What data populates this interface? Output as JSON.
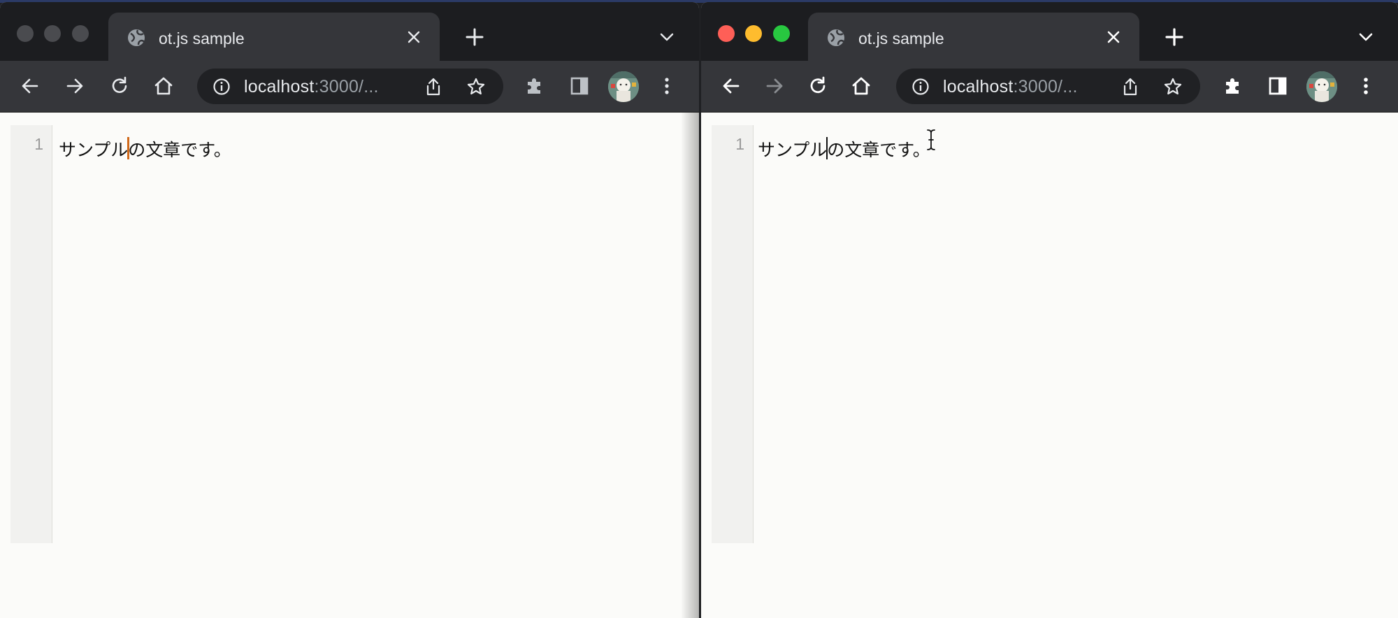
{
  "windows": [
    {
      "tab": {
        "title": "ot.js sample"
      },
      "omnibox": {
        "host": "localhost",
        "rest": ":3000/..."
      },
      "editor": {
        "line_numbers": [
          "1"
        ],
        "text_before_cursor": "サンプル",
        "text_after_cursor": "の文章です。",
        "cursor_color": "#d0691b"
      }
    },
    {
      "tab": {
        "title": "ot.js sample"
      },
      "omnibox": {
        "host": "localhost",
        "rest": ":3000/..."
      },
      "editor": {
        "line_numbers": [
          "1"
        ],
        "text_before_cursor": "サンプル",
        "text_after_cursor": "の文章です。",
        "cursor_color": "#111111"
      }
    }
  ],
  "icons": {
    "traffic_lights": [
      "close-traffic-light",
      "minimize-traffic-light",
      "maximize-traffic-light"
    ],
    "tab": [
      "globe-icon",
      "close-icon"
    ],
    "tabstrip": [
      "plus-icon",
      "chevron-down-icon"
    ],
    "toolbar": [
      "back-arrow-icon",
      "forward-arrow-icon",
      "reload-icon",
      "home-icon",
      "info-icon",
      "share-icon",
      "star-icon",
      "puzzle-icon",
      "side-panel-icon",
      "avatar",
      "kebab-menu-icon"
    ],
    "pointer": "ibeam-cursor-icon"
  },
  "colors": {
    "traffic_close": "#fe5f57",
    "traffic_minimize": "#febc2e",
    "traffic_maximize": "#28c840",
    "remote_cursor": "#d0691b",
    "tab_bg": "#35363a",
    "tabstrip_bg": "#1c1d20"
  }
}
